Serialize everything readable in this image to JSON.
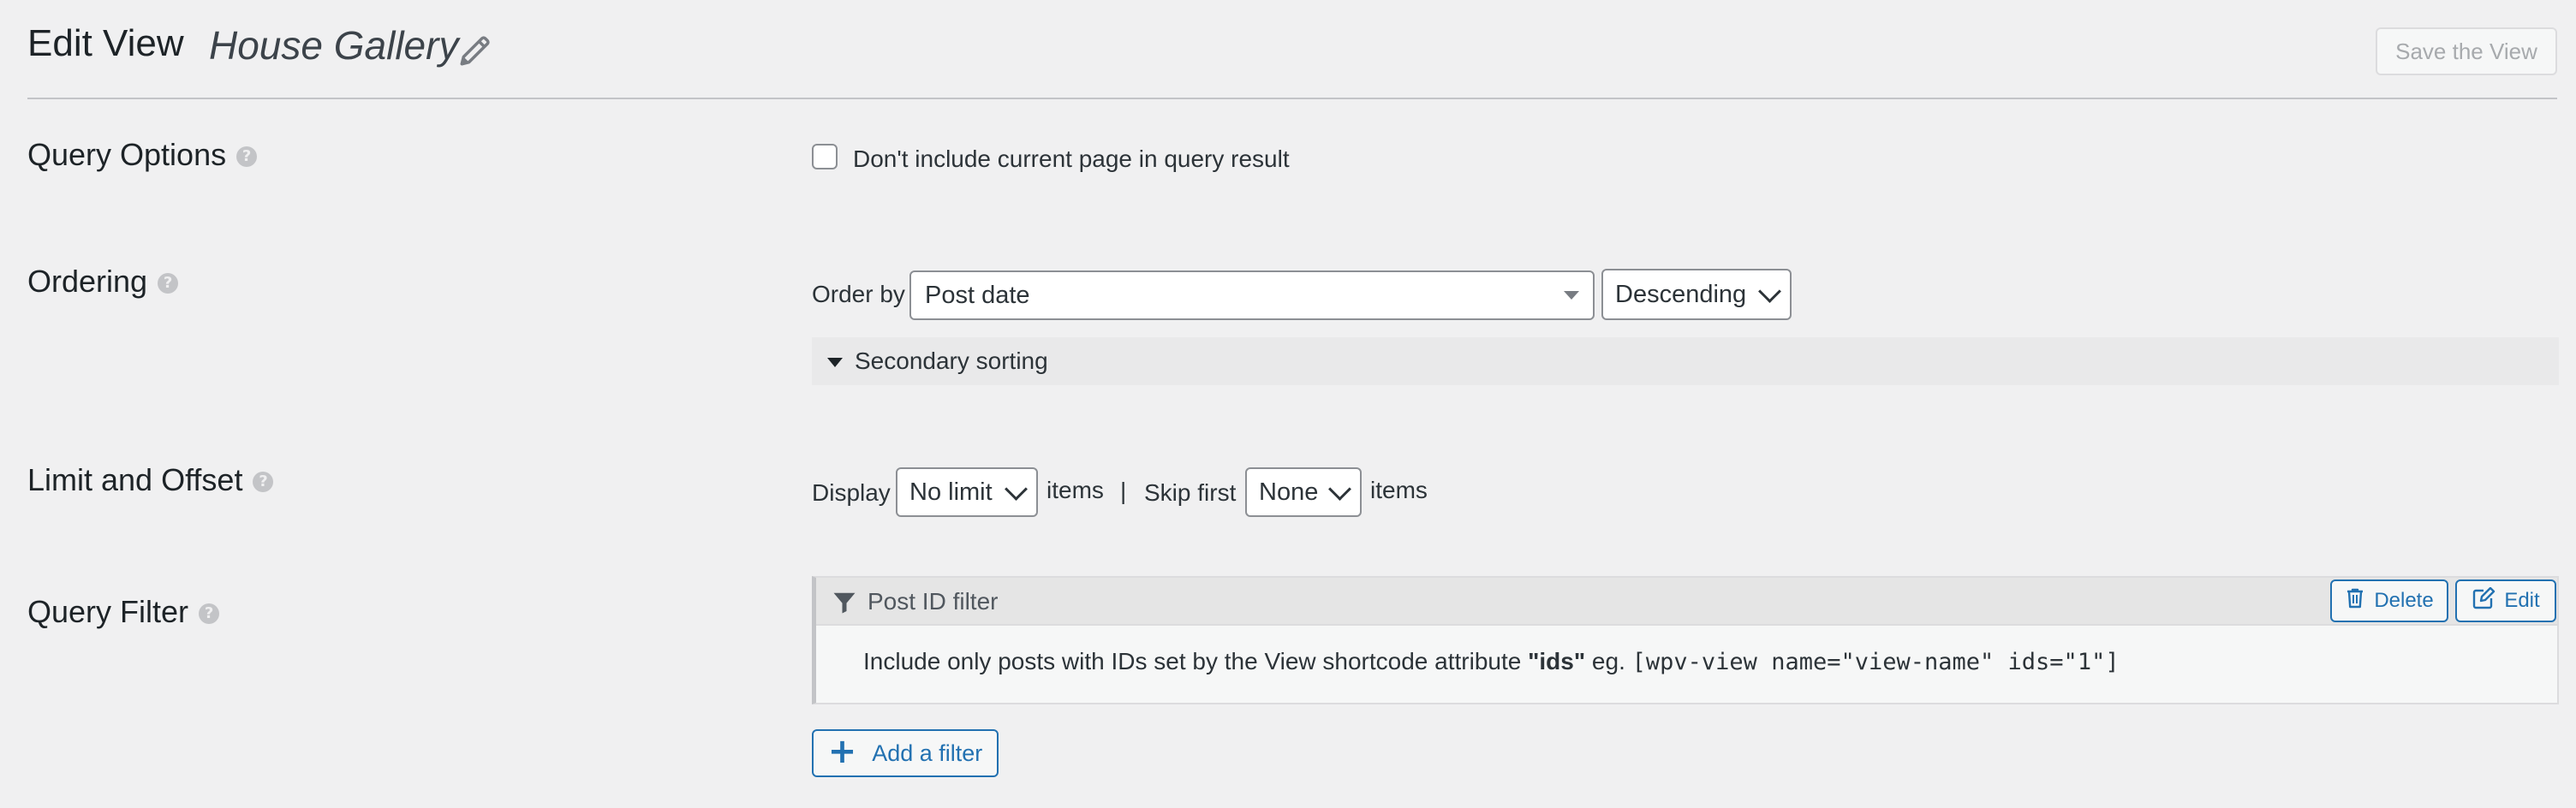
{
  "header": {
    "title": "Edit View",
    "view_name": "House Gallery",
    "save_label": "Save the View"
  },
  "query_options": {
    "title": "Query Options",
    "help": "?",
    "checkbox_label": "Don't include current page in query result",
    "checked": false
  },
  "ordering": {
    "title": "Ordering",
    "help": "?",
    "order_by_label": "Order by",
    "order_by_value": "Post date",
    "direction_value": "Descending",
    "secondary_label": "Secondary sorting"
  },
  "limit": {
    "title": "Limit and Offset",
    "help": "?",
    "display_label": "Display",
    "display_value": "No limit",
    "items_label_1": "items",
    "separator": "|",
    "skip_label": "Skip first",
    "skip_value": "None",
    "items_label_2": "items"
  },
  "query_filter": {
    "title": "Query Filter",
    "help": "?",
    "filter_name": "Post ID filter",
    "delete_label": "Delete",
    "edit_label": "Edit",
    "desc_prefix": "Include only posts with IDs set by the View shortcode attribute",
    "desc_attr": "\"ids\"",
    "desc_eg": "eg.",
    "desc_code": "[wpv-view name=\"view-name\" ids=\"1\"]",
    "add_label": "Add a filter"
  },
  "colors": {
    "accent": "#2271b1",
    "background": "#f0f0f1"
  }
}
